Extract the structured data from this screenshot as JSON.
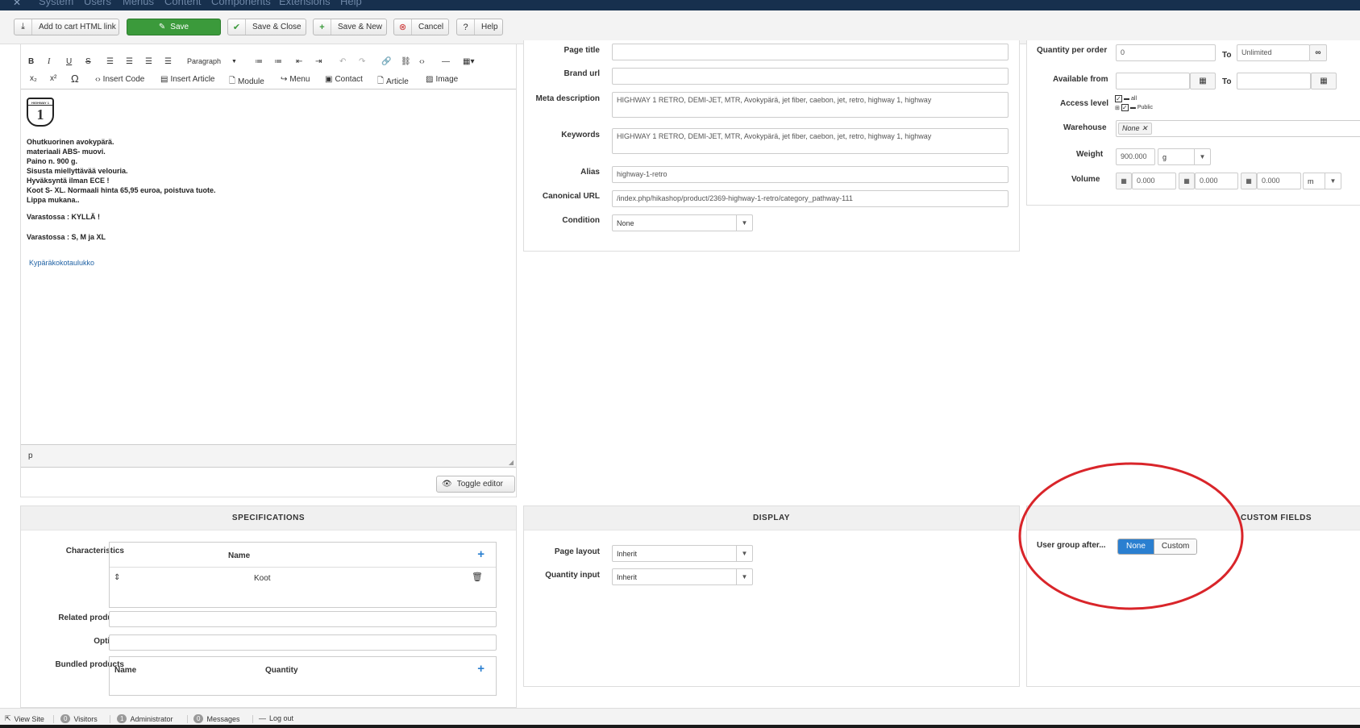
{
  "topnav": {
    "logo": "✕",
    "items": [
      "System",
      "Users",
      "Menus",
      "Content",
      "Components",
      "Extensions",
      "Help"
    ]
  },
  "toolbar": {
    "add_to_cart": "Add to cart HTML link",
    "save": "Save",
    "save_close": "Save & Close",
    "save_new": "Save & New",
    "cancel": "Cancel",
    "help": "Help"
  },
  "editor": {
    "paragraph_select": "Paragraph",
    "insert_code": "Insert Code",
    "insert_article": "Insert Article",
    "module": "Module",
    "menu": "Menu",
    "contact": "Contact",
    "article": "Article",
    "image": "Image",
    "logo_text": "HIGHWAY 1",
    "content_lines": [
      "Ohutkuorinen avokypärä.",
      "materiaali ABS- muovi.",
      "Paino n. 900 g.",
      "Sisusta miellyttävää velouria.",
      "Hyväksyntä ilman ECE !",
      "Koot S- XL. Normaali hinta 65,95 euroa, poistuva tuote.",
      "Lippa mukana.."
    ],
    "stock_yes": "Varastossa : KYLLÄ !",
    "stock_sizes": "Varastossa : S, M ja XL",
    "size_chart_link": "Kypäräkokotaulukko",
    "status_path": "p",
    "toggle_editor": "Toggle editor"
  },
  "seo": {
    "page_title_label": "Page title",
    "page_title_value": "",
    "brand_url_label": "Brand url",
    "brand_url_value": "",
    "meta_description_label": "Meta description",
    "meta_description_value": "HIGHWAY 1 RETRO, DEMI-JET, MTR, Avokypärä, jet fiber, caebon, jet, retro, highway 1, highway",
    "keywords_label": "Keywords",
    "keywords_value": "HIGHWAY 1 RETRO, DEMI-JET, MTR, Avokypärä, jet fiber, caebon, jet, retro, highway 1, highway",
    "alias_label": "Alias",
    "alias_value": "highway-1-retro",
    "canonical_label": "Canonical URL",
    "canonical_value": "/index.php/hikashop/product/2369-highway-1-retro/category_pathway-111",
    "condition_label": "Condition",
    "condition_value": "None"
  },
  "restrictions": {
    "qty_per_order_label": "Quantity per order",
    "qty_min": "0",
    "to_label": "To",
    "qty_max": "Unlimited",
    "available_from_label": "Available from",
    "access_level_label": "Access level",
    "access_all": "all",
    "access_public": "Public",
    "warehouse_label": "Warehouse",
    "warehouse_value": "None",
    "weight_label": "Weight",
    "weight_value": "900.000",
    "weight_unit": "g",
    "volume_label": "Volume",
    "volume_l": "0.000",
    "volume_w": "0.000",
    "volume_h": "0.000",
    "volume_unit": "m"
  },
  "specifications": {
    "title": "SPECIFICATIONS",
    "characteristics_label": "Characteristics",
    "name_header": "Name",
    "characteristic_row": "Koot",
    "related_label": "Related products",
    "options_label": "Options",
    "bundled_label": "Bundled products",
    "bundled_name": "Name",
    "bundled_quantity": "Quantity"
  },
  "display": {
    "title": "DISPLAY",
    "page_layout_label": "Page layout",
    "page_layout_value": "Inherit",
    "quantity_input_label": "Quantity input",
    "quantity_input_value": "Inherit"
  },
  "custom_fields": {
    "title": "CUSTOM FIELDS",
    "user_group_label": "User group after...",
    "none": "None",
    "custom": "Custom"
  },
  "footer": {
    "view_site": "View Site",
    "visitors_count": "0",
    "visitors": "Visitors",
    "admin_count": "1",
    "administrator": "Administrator",
    "messages_count": "0",
    "messages": "Messages",
    "logout": "Log out"
  },
  "colors": {
    "save_green": "#3b9a3b",
    "toggle_active": "#2a7fd0",
    "annotation_red": "#d9252a",
    "topbar": "#17304e"
  }
}
